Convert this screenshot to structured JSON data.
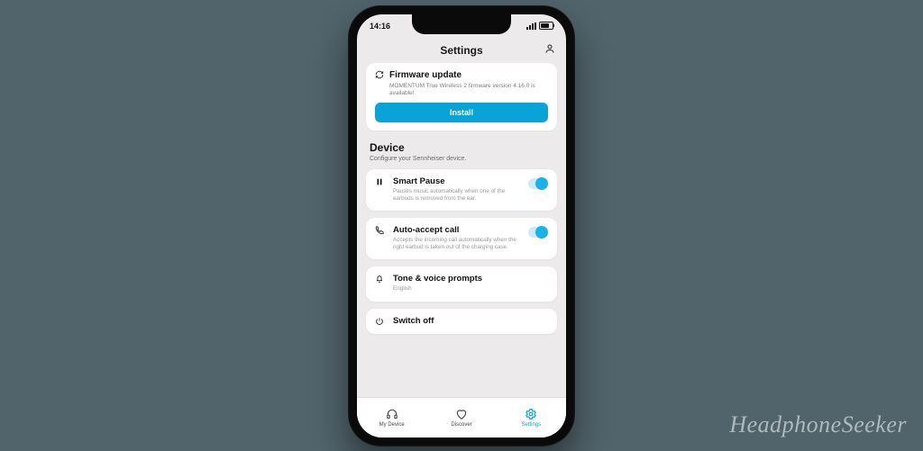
{
  "status": {
    "time": "14:16"
  },
  "header": {
    "title": "Settings"
  },
  "firmware": {
    "title": "Firmware update",
    "subtitle": "MOMENTUM True Wireless 2 firmware version 4.16.0 is available!",
    "button": "Install"
  },
  "deviceSection": {
    "title": "Device",
    "subtitle": "Configure your Sennheiser device."
  },
  "smartPause": {
    "title": "Smart Pause",
    "subtitle": "Pauses music automatically when one of the earbuds is removed from the ear.",
    "on": true
  },
  "autoAccept": {
    "title": "Auto-accept call",
    "subtitle": "Accepts the incoming call automatically when the right earbud is taken out of the charging case.",
    "on": true
  },
  "tone": {
    "title": "Tone & voice prompts",
    "subtitle": "English"
  },
  "switchOff": {
    "title": "Switch off"
  },
  "tabs": {
    "device": "My Device",
    "discover": "Discover",
    "settings": "Settings"
  },
  "watermark": "HeadphoneSeeker",
  "colors": {
    "accent": "#0aa3d8",
    "bg": "#51646b"
  }
}
